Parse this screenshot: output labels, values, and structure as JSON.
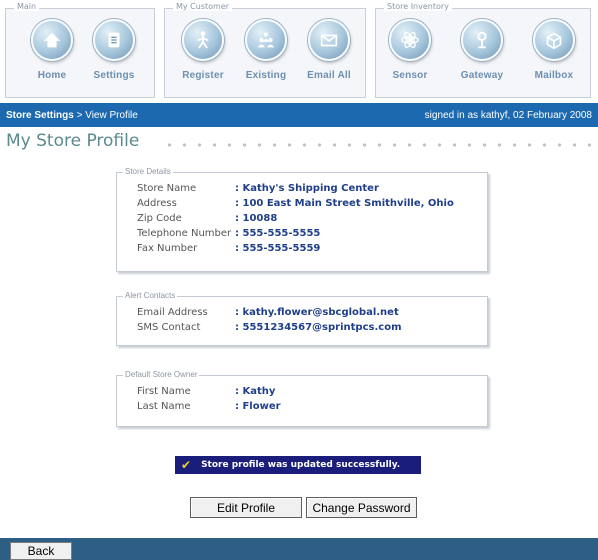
{
  "toolbar": {
    "groups": [
      {
        "label": "Main",
        "buttons": [
          {
            "label": "Home",
            "icon": "home-icon"
          },
          {
            "label": "Settings",
            "icon": "settings-icon"
          }
        ]
      },
      {
        "label": "My Customer",
        "buttons": [
          {
            "label": "Register",
            "icon": "register-icon"
          },
          {
            "label": "Existing",
            "icon": "existing-icon"
          },
          {
            "label": "Email All",
            "icon": "email-icon"
          }
        ]
      },
      {
        "label": "Store Inventory",
        "buttons": [
          {
            "label": "Sensor",
            "icon": "sensor-icon"
          },
          {
            "label": "Gateway",
            "icon": "gateway-icon"
          },
          {
            "label": "Mailbox",
            "icon": "mailbox-icon"
          }
        ]
      }
    ]
  },
  "nav": {
    "section": "Store Settings",
    "separator": " > ",
    "page": "View Profile",
    "signed_in": "signed in as kathyf, 02 February 2008"
  },
  "page_title": "My Store Profile",
  "store_details": {
    "legend": "Store Details",
    "rows": [
      {
        "label": "Store Name",
        "value": ": Kathy's Shipping Center"
      },
      {
        "label": "Address",
        "value": ": 100 East Main Street Smithville, Ohio"
      },
      {
        "label": "Zip Code",
        "value": ": 10088"
      },
      {
        "label": "Telephone Number",
        "value": ": 555-555-5555"
      },
      {
        "label": "Fax Number",
        "value": ": 555-555-5559"
      }
    ]
  },
  "alert_contacts": {
    "legend": "Alert Contacts",
    "rows": [
      {
        "label": "Email Address",
        "value": ": kathy.flower@sbcglobal.net"
      },
      {
        "label": "SMS Contact",
        "value": ": 5551234567@sprintpcs.com"
      }
    ]
  },
  "store_owner": {
    "legend": "Default Store Owner",
    "rows": [
      {
        "label": "First Name",
        "value": ": Kathy"
      },
      {
        "label": "Last Name",
        "value": ": Flower"
      }
    ]
  },
  "message": "Store profile was updated successfully.",
  "buttons": {
    "edit_profile": "Edit Profile",
    "change_password": "Change Password",
    "back": "Back"
  },
  "colors": {
    "nav_bar": "#1c69b0",
    "footer": "#2d5f85",
    "title": "#5a8a8d",
    "value_text": "#1f3f8a",
    "message_bg": "#1a1d7a",
    "check": "#f2cf2a"
  }
}
